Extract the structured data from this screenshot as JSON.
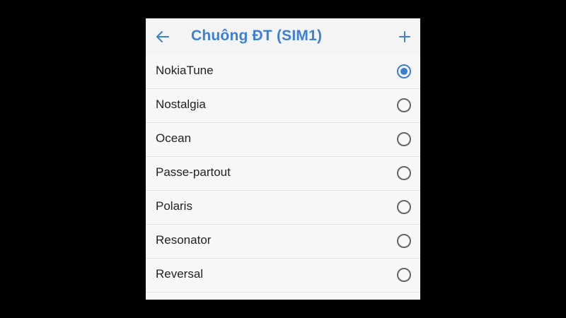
{
  "header": {
    "title": "Chuông ĐT (SIM1)",
    "back_icon": "arrow-left-icon",
    "add_icon": "plus-icon",
    "accent_color": "#3d7fd4"
  },
  "ringtones": [
    {
      "label": "NokiaTune",
      "selected": true
    },
    {
      "label": "Nostalgia",
      "selected": false
    },
    {
      "label": "Ocean",
      "selected": false
    },
    {
      "label": "Passe-partout",
      "selected": false
    },
    {
      "label": "Polaris",
      "selected": false
    },
    {
      "label": "Resonator",
      "selected": false
    },
    {
      "label": "Reversal",
      "selected": false
    }
  ]
}
